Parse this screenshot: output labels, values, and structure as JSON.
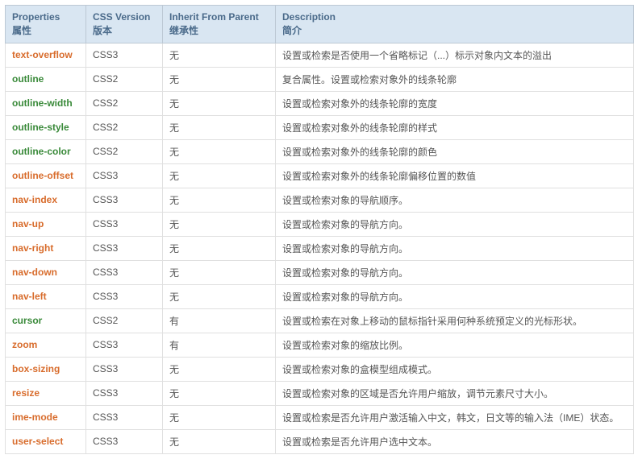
{
  "headers": [
    {
      "en": "Properties",
      "zh": "属性"
    },
    {
      "en": "CSS Version",
      "zh": "版本"
    },
    {
      "en": "Inherit From Parent",
      "zh": "继承性"
    },
    {
      "en": "Description",
      "zh": "简介"
    }
  ],
  "rows": [
    {
      "prop": "text-overflow",
      "ver": "CSS3",
      "inherit": "无",
      "desc": "设置或检索是否使用一个省略标记（...）标示对象内文本的溢出"
    },
    {
      "prop": "outline",
      "ver": "CSS2",
      "inherit": "无",
      "desc": "复合属性。设置或检索对象外的线条轮廓"
    },
    {
      "prop": "outline-width",
      "ver": "CSS2",
      "inherit": "无",
      "desc": "设置或检索对象外的线条轮廓的宽度"
    },
    {
      "prop": "outline-style",
      "ver": "CSS2",
      "inherit": "无",
      "desc": "设置或检索对象外的线条轮廓的样式"
    },
    {
      "prop": "outline-color",
      "ver": "CSS2",
      "inherit": "无",
      "desc": "设置或检索对象外的线条轮廓的颜色"
    },
    {
      "prop": "outline-offset",
      "ver": "CSS3",
      "inherit": "无",
      "desc": "设置或检索对象外的线条轮廓偏移位置的数值"
    },
    {
      "prop": "nav-index",
      "ver": "CSS3",
      "inherit": "无",
      "desc": "设置或检索对象的导航顺序。"
    },
    {
      "prop": "nav-up",
      "ver": "CSS3",
      "inherit": "无",
      "desc": "设置或检索对象的导航方向。"
    },
    {
      "prop": "nav-right",
      "ver": "CSS3",
      "inherit": "无",
      "desc": "设置或检索对象的导航方向。"
    },
    {
      "prop": "nav-down",
      "ver": "CSS3",
      "inherit": "无",
      "desc": "设置或检索对象的导航方向。"
    },
    {
      "prop": "nav-left",
      "ver": "CSS3",
      "inherit": "无",
      "desc": "设置或检索对象的导航方向。"
    },
    {
      "prop": "cursor",
      "ver": "CSS2",
      "inherit": "有",
      "desc": "设置或检索在对象上移动的鼠标指针采用何种系统预定义的光标形状。"
    },
    {
      "prop": "zoom",
      "ver": "CSS3",
      "inherit": "有",
      "desc": "设置或检索对象的缩放比例。"
    },
    {
      "prop": "box-sizing",
      "ver": "CSS3",
      "inherit": "无",
      "desc": "设置或检索对象的盒模型组成模式。"
    },
    {
      "prop": "resize",
      "ver": "CSS3",
      "inherit": "无",
      "desc": "设置或检索对象的区域是否允许用户缩放，调节元素尺寸大小。"
    },
    {
      "prop": "ime-mode",
      "ver": "CSS3",
      "inherit": "无",
      "desc": "设置或检索是否允许用户激活输入中文，韩文，日文等的输入法（IME）状态。"
    },
    {
      "prop": "user-select",
      "ver": "CSS3",
      "inherit": "无",
      "desc": "设置或检索是否允许用户选中文本。"
    }
  ]
}
